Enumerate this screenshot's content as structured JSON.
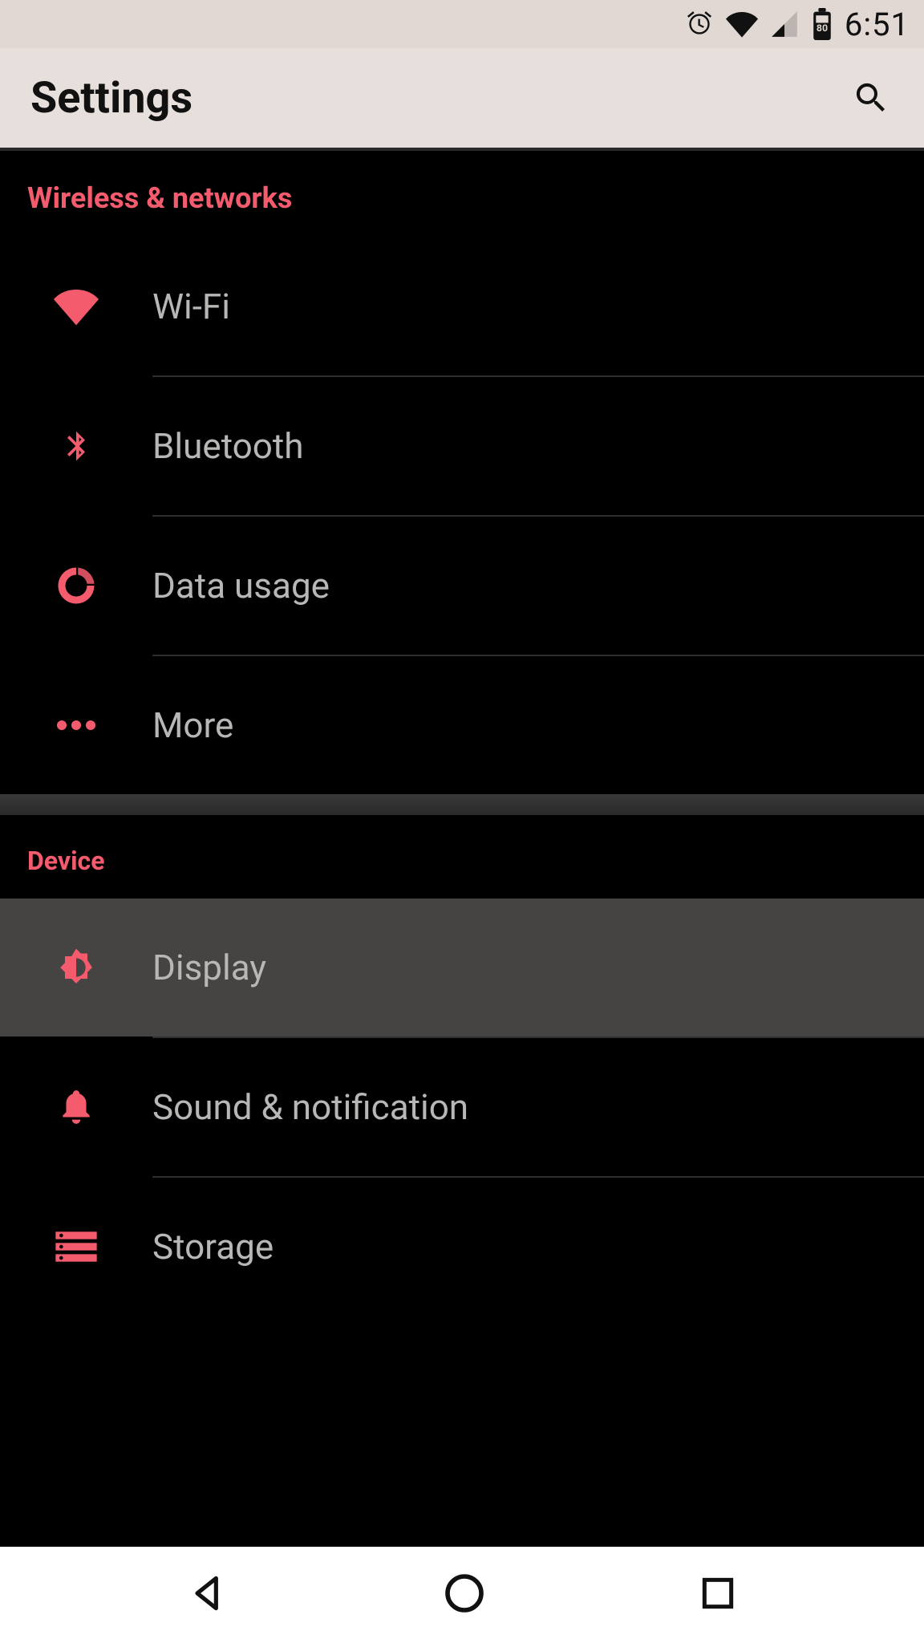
{
  "colors": {
    "accent": "#f45c6d",
    "status_bg": "#e1d8d4",
    "appbar_bg": "#e7dfdc",
    "highlight_bg": "#464442"
  },
  "status": {
    "time": "6:51",
    "battery": "80"
  },
  "header": {
    "title": "Settings"
  },
  "sections": {
    "wireless": {
      "title": "Wireless & networks",
      "items": [
        {
          "id": "wifi",
          "label": "Wi-Fi",
          "icon": "wifi-icon"
        },
        {
          "id": "bluetooth",
          "label": "Bluetooth",
          "icon": "bluetooth-icon"
        },
        {
          "id": "data",
          "label": "Data usage",
          "icon": "data-usage-icon"
        },
        {
          "id": "more",
          "label": "More",
          "icon": "more-horizontal-icon"
        }
      ]
    },
    "device": {
      "title": "Device",
      "items": [
        {
          "id": "display",
          "label": "Display",
          "icon": "brightness-icon",
          "highlighted": true
        },
        {
          "id": "sound",
          "label": "Sound & notification",
          "icon": "bell-icon"
        },
        {
          "id": "storage",
          "label": "Storage",
          "icon": "storage-icon"
        }
      ]
    }
  }
}
